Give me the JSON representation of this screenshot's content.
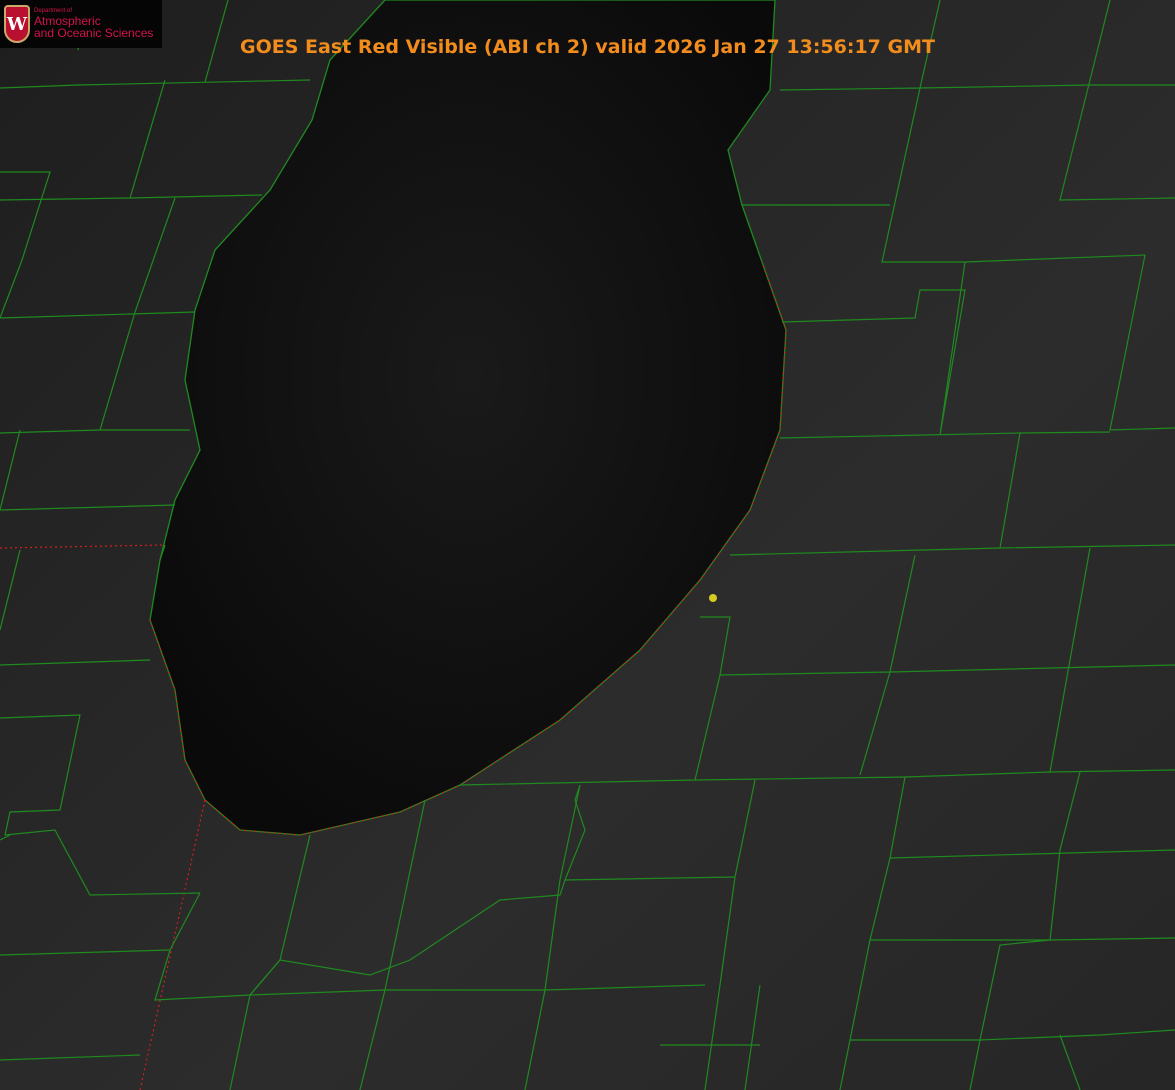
{
  "title": "GOES East Red Visible (ABI ch 2) valid 2026 Jan 27 13:56:17 GMT",
  "logo": {
    "dept": "Department of",
    "line1": "Atmospheric",
    "line2": "and Oceanic Sciences",
    "shield_letter": "W"
  },
  "colors": {
    "title": "#f28c1c",
    "county_lines": "#1f8a1f",
    "state_lines": "#d02020",
    "marker": "#d4cc20",
    "logo_text": "#d3124a"
  },
  "marker": {
    "icon": "point-marker"
  }
}
